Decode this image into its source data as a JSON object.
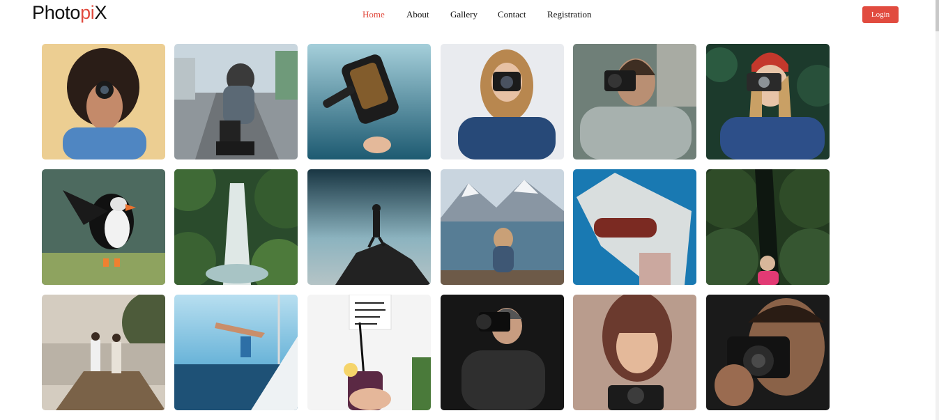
{
  "logo": {
    "part1": "Photo",
    "part2": "pi",
    "part3": "X"
  },
  "nav": {
    "items": [
      {
        "label": "Home",
        "active": true
      },
      {
        "label": "About",
        "active": false
      },
      {
        "label": "Gallery",
        "active": false
      },
      {
        "label": "Contact",
        "active": false
      },
      {
        "label": "Registration",
        "active": false
      }
    ]
  },
  "login_label": "Login",
  "colors": {
    "accent": "#e14b3f",
    "text": "#111111"
  },
  "gallery": {
    "photos": [
      {
        "subject": "woman-with-camera-yellow-bg",
        "tone": [
          "#e8c88a",
          "#4a7bb5"
        ]
      },
      {
        "subject": "man-crouching-street",
        "tone": [
          "#9eb4c2",
          "#2b2b2b"
        ]
      },
      {
        "subject": "underwater-camera-ocean",
        "tone": [
          "#6aa6b8",
          "#1f5a73"
        ]
      },
      {
        "subject": "woman-camera-white-bg",
        "tone": [
          "#e6e8ec",
          "#24406a"
        ]
      },
      {
        "subject": "man-camera-outdoor",
        "tone": [
          "#7f8a88",
          "#a4acab"
        ]
      },
      {
        "subject": "woman-red-beanie-camera",
        "tone": [
          "#1d3a2e",
          "#2e4f88"
        ]
      },
      {
        "subject": "puffin-bird",
        "tone": [
          "#3f5c52",
          "#cfe0b4"
        ]
      },
      {
        "subject": "forest-waterfall",
        "tone": [
          "#27432a",
          "#6f8f54"
        ]
      },
      {
        "subject": "hiker-on-rock",
        "tone": [
          "#1e3f4b",
          "#8ab1bd"
        ]
      },
      {
        "subject": "woman-lake-mountains",
        "tone": [
          "#b6c3cf",
          "#47677e"
        ]
      },
      {
        "subject": "person-lace-blanket",
        "tone": [
          "#1a79b3",
          "#e8e6e2"
        ]
      },
      {
        "subject": "child-in-hedge",
        "tone": [
          "#21381f",
          "#3b5a2d"
        ]
      },
      {
        "subject": "couple-on-pier",
        "tone": [
          "#bfb6a4",
          "#6a5640"
        ]
      },
      {
        "subject": "man-jumping-boat",
        "tone": [
          "#5fb3d8",
          "#1f4f73"
        ]
      },
      {
        "subject": "drink-with-note",
        "tone": [
          "#f2f2f2",
          "#5a2a45"
        ]
      },
      {
        "subject": "photographer-dark",
        "tone": [
          "#141414",
          "#5a5a5a"
        ]
      },
      {
        "subject": "woman-smiling-camera",
        "tone": [
          "#a88d80",
          "#3a2622"
        ]
      },
      {
        "subject": "man-camera-closeup",
        "tone": [
          "#191919",
          "#6b5442"
        ]
      }
    ]
  }
}
